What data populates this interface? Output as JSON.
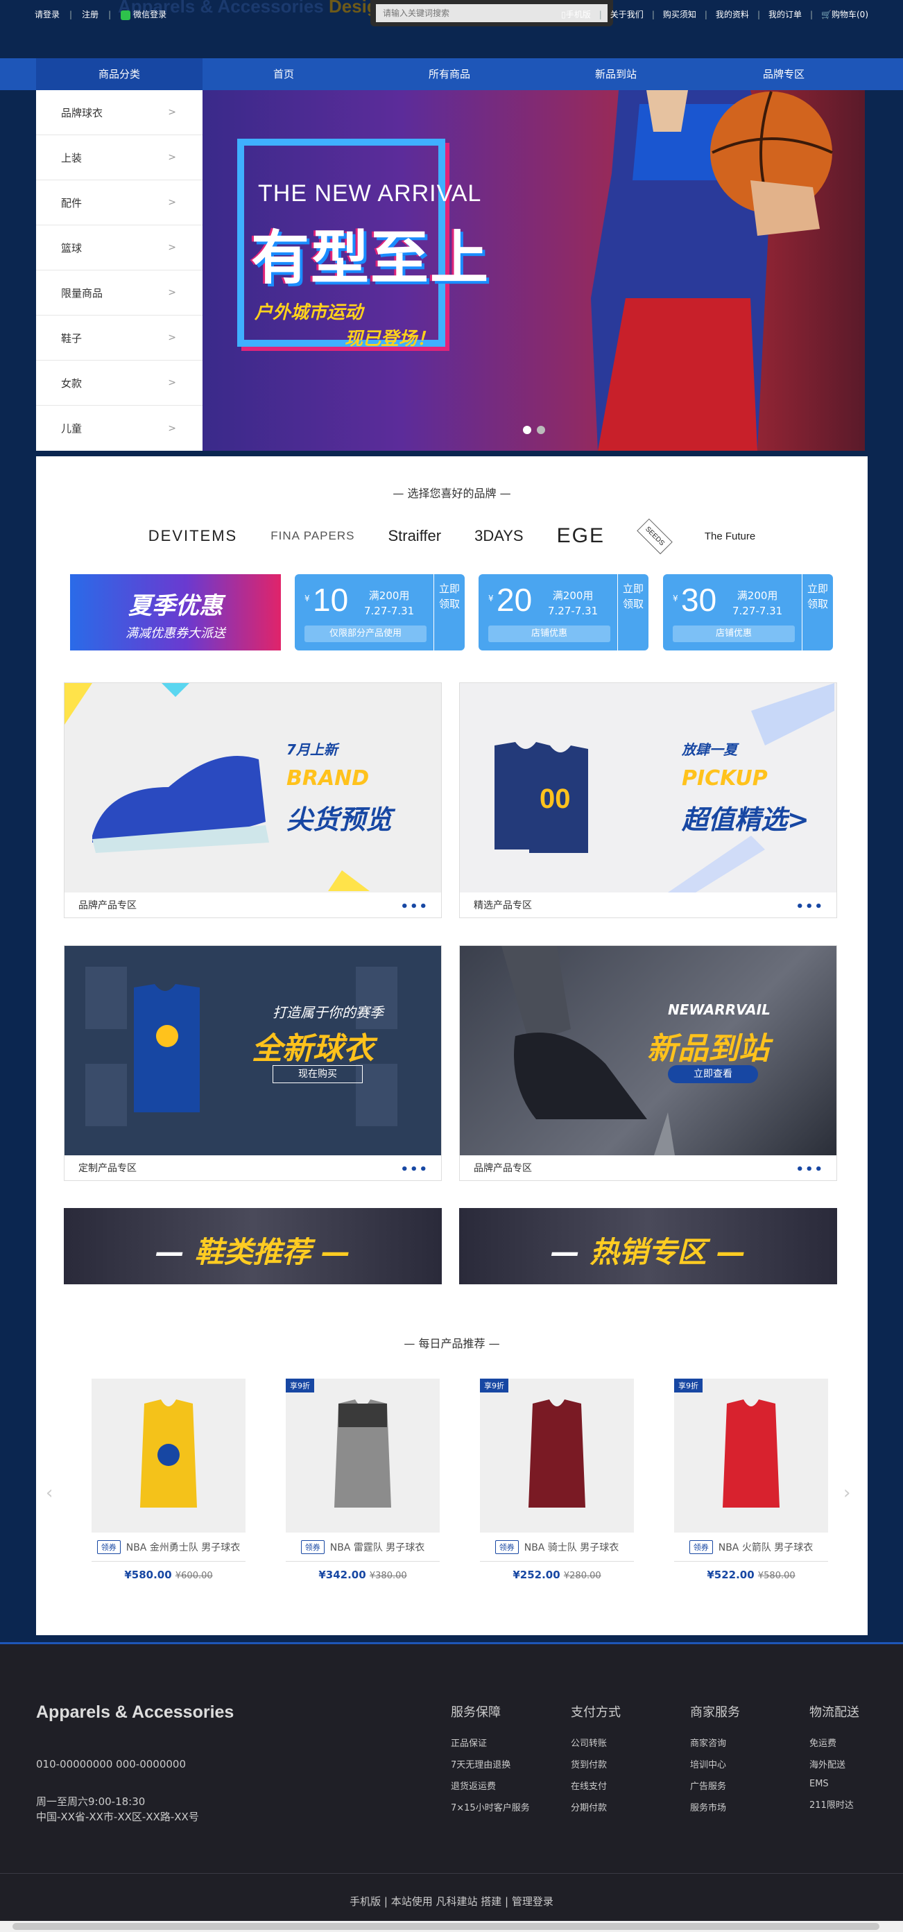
{
  "topbar": {
    "login": "请登录",
    "register": "注册",
    "wechat_login": "微信登录",
    "logo_ghost_a": "Apparels & Accessories",
    "logo_ghost_b": "Design",
    "search_placeholder": "请输入关键词搜索",
    "links": [
      "手机版",
      "关于我们",
      "购买须知",
      "我的资料",
      "我的订单",
      "购物车(0)"
    ]
  },
  "nav": {
    "category_label": "商品分类",
    "items": [
      "首页",
      "所有商品",
      "新品到站",
      "品牌专区"
    ]
  },
  "sidebar": {
    "items": [
      "品牌球衣",
      "上装",
      "配件",
      "篮球",
      "限量商品",
      "鞋子",
      "女款",
      "儿童"
    ],
    "arrow": ">"
  },
  "banner": {
    "en": "THE NEW ARRIVAL",
    "cn": "有型至上",
    "sub1": "户外城市运动",
    "sub2": "现已登场！"
  },
  "brands": {
    "title": "— 选择您喜好的品牌 —",
    "items": [
      "DEVITEMS",
      "FINA PAPERS",
      "Straiffer",
      "3DAYS",
      "EGE",
      "SEEDS",
      "The Future"
    ]
  },
  "promo": {
    "title": "夏季优惠",
    "subtitle": "满减优惠券大派送"
  },
  "coupons": [
    {
      "currency": "¥",
      "amount": "10",
      "cond": "满200用",
      "date": "7.27-7.31",
      "note": "仅限部分产品使用",
      "get": "立即领取"
    },
    {
      "currency": "¥",
      "amount": "20",
      "cond": "满200用",
      "date": "7.27-7.31",
      "note": "店铺优惠",
      "get": "立即领取"
    },
    {
      "currency": "¥",
      "amount": "30",
      "cond": "满200用",
      "date": "7.27-7.31",
      "note": "店铺优惠",
      "get": "立即领取"
    }
  ],
  "tiles": [
    {
      "caption": "品牌产品专区",
      "line1": "7月上新",
      "line2": "BRAND",
      "line3": "尖货预览"
    },
    {
      "caption": "精选产品专区",
      "line1": "放肆一夏",
      "line2": "PICKUP",
      "line3": "超值精选>"
    },
    {
      "caption": "定制产品专区",
      "line1": "打造属于你的赛季",
      "line2": "全新球衣",
      "line3": "现在购买"
    },
    {
      "caption": "品牌产品专区",
      "line1": "NEWARRVAIL",
      "line2": "新品到站",
      "line3": "立即查看"
    }
  ],
  "more_dots": "•••",
  "strips": [
    {
      "dash": "—",
      "text": "鞋类推荐"
    },
    {
      "dash": "—",
      "text": "热销专区"
    }
  ],
  "daily": {
    "title": "— 每日产品推荐 —",
    "tag": "领券",
    "products": [
      {
        "badge": "",
        "name": "NBA 金州勇士队 男子球衣",
        "price": "¥580.00",
        "old_price": "¥600.00",
        "color": "#f4c21a"
      },
      {
        "badge": "享9折",
        "name": "NBA 雷霆队 男子球衣",
        "price": "¥342.00",
        "old_price": "¥380.00",
        "color": "#8c8c8c"
      },
      {
        "badge": "享9折",
        "name": "NBA 骑士队 男子球衣",
        "price": "¥252.00",
        "old_price": "¥280.00",
        "color": "#7a1a24"
      },
      {
        "badge": "享9折",
        "name": "NBA 火箭队 男子球衣",
        "price": "¥522.00",
        "old_price": "¥580.00",
        "color": "#d8222e"
      }
    ]
  },
  "footer": {
    "brand": "Apparels & Accessories",
    "phone": "010-00000000 000-0000000",
    "hours": "周一至周六9:00-18:30",
    "address": "中国-XX省-XX市-XX区-XX路-XX号",
    "columns": [
      {
        "title": "服务保障",
        "links": [
          "正品保证",
          "7天无理由退换",
          "退货返运费",
          "7×15小时客户服务"
        ]
      },
      {
        "title": "支付方式",
        "links": [
          "公司转账",
          "货到付款",
          "在线支付",
          "分期付款"
        ]
      },
      {
        "title": "商家服务",
        "links": [
          "商家咨询",
          "培训中心",
          "广告服务",
          "服务市场"
        ]
      },
      {
        "title": "物流配送",
        "links": [
          "免运费",
          "海外配送",
          "EMS",
          "211限时达"
        ]
      }
    ],
    "bottom": "手机版 | 本站使用 凡科建站 搭建 | 管理登录"
  },
  "colors": {
    "nav_blue": "#1e56b8",
    "accent": "#1747a3",
    "page_bg": "#0b2650"
  }
}
